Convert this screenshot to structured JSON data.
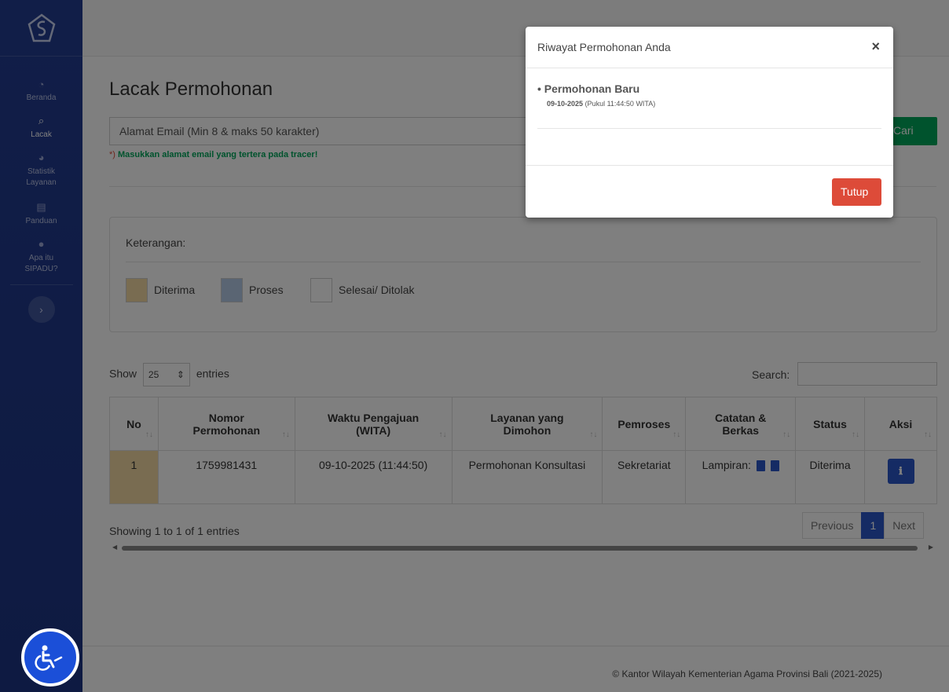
{
  "sidebar": {
    "items": [
      {
        "label": "Beranda",
        "icon": "dashboard-icon",
        "glyph": "◔"
      },
      {
        "label": "Lacak",
        "icon": "search-icon",
        "glyph": "⌕"
      },
      {
        "label": "Statistik Layanan",
        "icon": "pie-chart-icon",
        "glyph": "◕"
      },
      {
        "label": "Panduan",
        "icon": "book-icon",
        "glyph": "▤"
      },
      {
        "label": "Apa itu SIPADU?",
        "icon": "info-icon",
        "glyph": "●"
      }
    ],
    "toggle_glyph": "›"
  },
  "main": {
    "title": "Lacak Permohonan",
    "email_placeholder": "Alamat Email (Min 8 & maks 50 karakter)",
    "search_button": "Cari",
    "hint_req": "*)",
    "hint_text": "Masukkan alamat email yang tertera pada tracer!"
  },
  "legend": {
    "title": "Keterangan:",
    "items": [
      {
        "label": "Diterima",
        "color": "#f3d9a2"
      },
      {
        "label": "Proses",
        "color": "#b4cbe6"
      },
      {
        "label": "Selesai/ Ditolak",
        "color": "#ffffff"
      }
    ]
  },
  "table_controls": {
    "show_label": "Show",
    "entries_value": "25",
    "entries_label": "entries",
    "search_label": "Search:"
  },
  "table": {
    "headers": [
      "No",
      "Nomor Permohonan",
      "Waktu Pengajuan (WITA)",
      "Layanan yang Dimohon",
      "Pemroses",
      "Catatan & Berkas",
      "Status",
      "Aksi"
    ],
    "rows": [
      {
        "no": "1",
        "nomor": "1759981431",
        "waktu": "09-10-2025 (11:44:50)",
        "layanan": "Permohonan Konsultasi",
        "pemroses": "Sekretariat",
        "catatan": "Lampiran:",
        "status": "Diterima"
      }
    ]
  },
  "pagination": {
    "info": "Showing 1 to 1 of 1 entries",
    "previous": "Previous",
    "current": "1",
    "next": "Next"
  },
  "footer": {
    "text": "© Kantor Wilayah Kementerian Agama Provinsi Bali (2021-2025)"
  },
  "modal": {
    "title": "Riwayat Permohonan Anda",
    "close": "×",
    "item_title": "• Permohonan Baru",
    "item_date": "09-10-2025",
    "item_time": "(Pukul 11:44:50 WITA)",
    "close_button": "Tutup"
  },
  "colors": {
    "sidebar": "#233c91",
    "accent_blue": "#2b57c9",
    "green": "#00a65a",
    "red": "#dd4b39"
  }
}
